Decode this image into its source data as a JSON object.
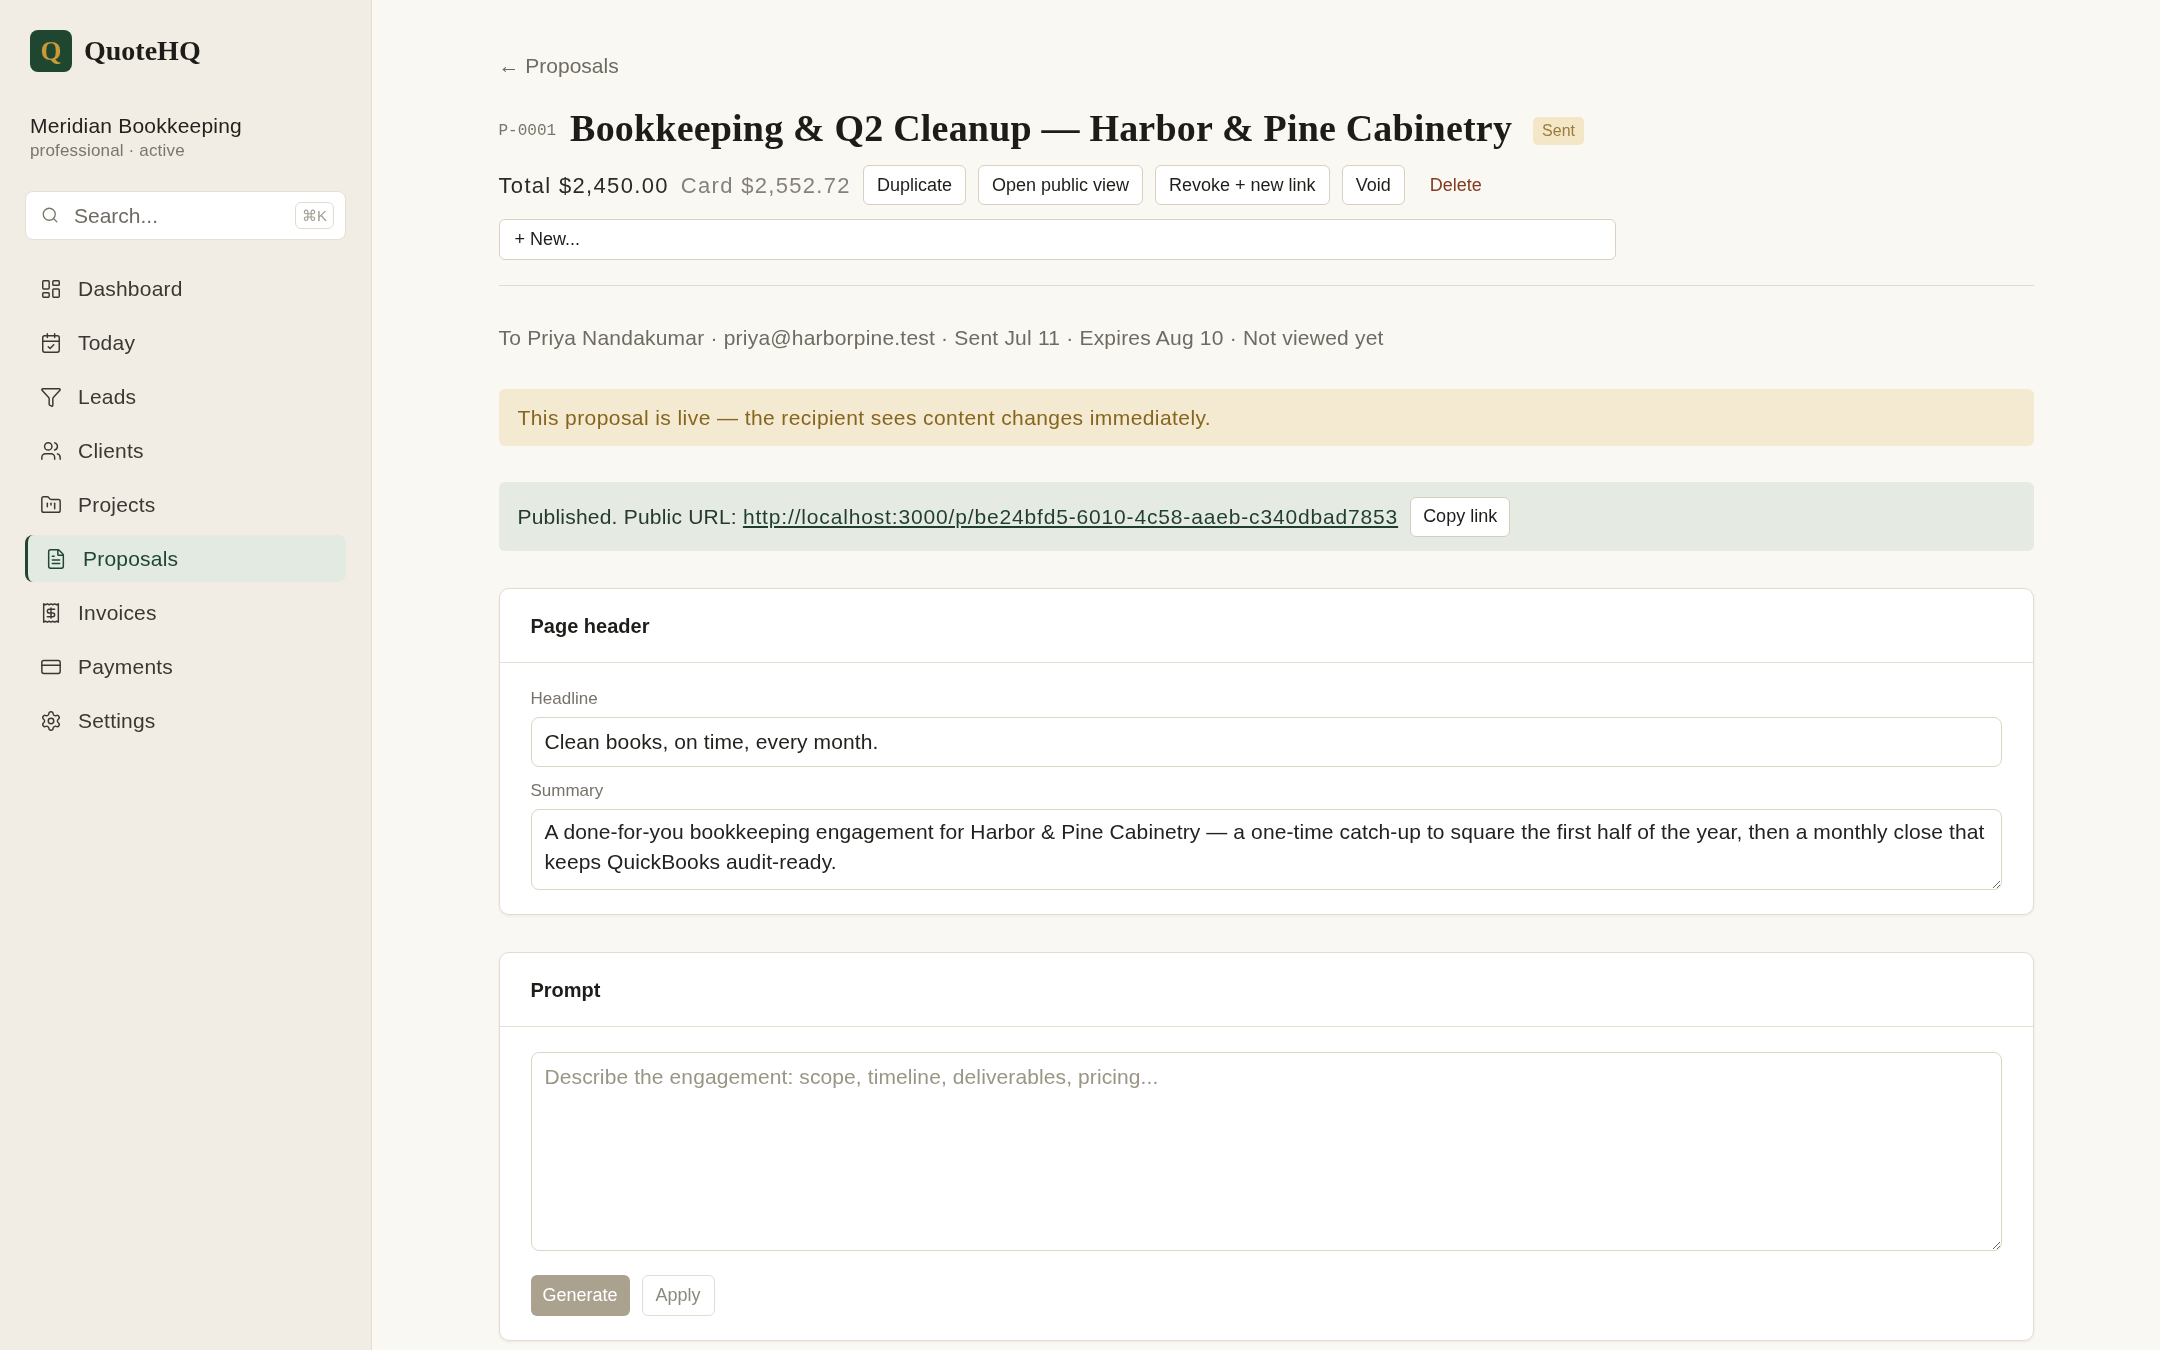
{
  "sidebar": {
    "brand": {
      "logo_letter": "Q",
      "name": "QuoteHQ"
    },
    "workspace": {
      "name": "Meridian Bookkeeping",
      "details": "professional · active"
    },
    "search": {
      "placeholder": "Search...",
      "shortcut": "⌘K"
    },
    "nav": [
      {
        "label": "Dashboard",
        "selected": false
      },
      {
        "label": "Today",
        "selected": false
      },
      {
        "label": "Leads",
        "selected": false
      },
      {
        "label": "Clients",
        "selected": false
      },
      {
        "label": "Projects",
        "selected": false
      },
      {
        "label": "Proposals",
        "selected": true
      },
      {
        "label": "Invoices",
        "selected": false
      },
      {
        "label": "Payments",
        "selected": false
      },
      {
        "label": "Settings",
        "selected": false
      }
    ]
  },
  "main": {
    "back_link": "← Proposals",
    "proposal": {
      "number": "P-0001",
      "title": "Bookkeeping & Q2 Cleanup — Harbor & Pine Cabinetry",
      "status": "Sent"
    },
    "total": "Total $2,450.00",
    "card_total": "Card $2,552.72",
    "actions": [
      {
        "label": "Duplicate",
        "kind": "button"
      },
      {
        "label": "Open public view",
        "kind": "button"
      },
      {
        "label": "Revoke + new link",
        "kind": "button"
      },
      {
        "label": "Void",
        "kind": "button"
      },
      {
        "label": "Delete",
        "kind": "danger_link"
      }
    ],
    "add_section": {
      "value": "+ New..."
    },
    "recipient_line": "To Priya Nandakumar · priya@harborpine.test · Sent Jul 11 · Expires Aug 10 · Not viewed yet",
    "live_notice": "This proposal is live — the recipient sees content changes immediately.",
    "published": {
      "label": "Published. Public URL:",
      "url": "http://localhost:3000/p/be24bfd5-6010-4c58-aaeb-c340dbad7853",
      "copy_button": "Copy link"
    },
    "sections": [
      {
        "kind": "fields",
        "title": "Page header",
        "fields": [
          {
            "kind": "input",
            "label": "Headline",
            "value": "Clean books, on time, every month."
          },
          {
            "kind": "textarea",
            "label": "Summary",
            "value": "A done-for-you bookkeeping engagement for Harbor & Pine Cabinetry — a one-time catch-up to square the first half of the year, then a monthly close that keeps QuickBooks audit-ready."
          }
        ]
      },
      {
        "kind": "prompt",
        "title": "Prompt",
        "prompt": {
          "placeholder": "Describe the engagement: scope, timeline, deliverables, pricing..."
        },
        "buttons": [
          {
            "label": "Generate",
            "kind": "primary",
            "disabled": true
          },
          {
            "label": "Apply",
            "kind": "secondary",
            "disabled": true
          }
        ]
      }
    ]
  }
}
